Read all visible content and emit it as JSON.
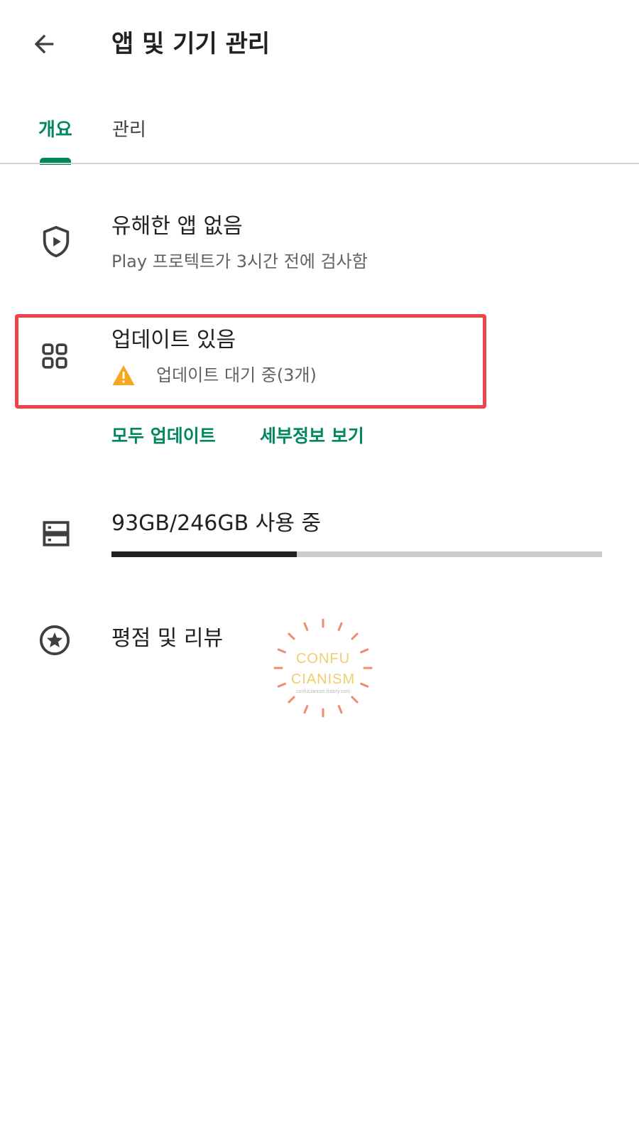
{
  "header": {
    "title": "앱 및 기기 관리",
    "back_icon": "arrow-back-icon"
  },
  "tabs": [
    {
      "label": "개요",
      "selected": true
    },
    {
      "label": "관리",
      "selected": false
    }
  ],
  "colors": {
    "accent": "#01875f",
    "highlight": "#f0444b",
    "warning": "#f5a623",
    "text_primary": "#202124",
    "text_secondary": "#5f6368"
  },
  "protect": {
    "icon": "shield-play-icon",
    "title": "유해한 앱 없음",
    "subtitle": "Play 프로텍트가 3시간 전에 검사함"
  },
  "updates": {
    "icon": "apps-grid-icon",
    "title": "업데이트 있음",
    "status_icon": "warning-icon",
    "status": "업데이트 대기 중(3개)",
    "update_all_label": "모두 업데이트",
    "details_label": "세부정보 보기"
  },
  "storage": {
    "icon": "storage-icon",
    "label": "93GB/246GB 사용 중",
    "used_gb": 93,
    "total_gb": 246,
    "used_fraction": 0.378
  },
  "ratings": {
    "icon": "star-circle-icon",
    "label": "평점 및 리뷰"
  },
  "watermark": {
    "line1": "CONFU",
    "line2": "CIANISM",
    "line3": "confucianism.tistory.com"
  }
}
